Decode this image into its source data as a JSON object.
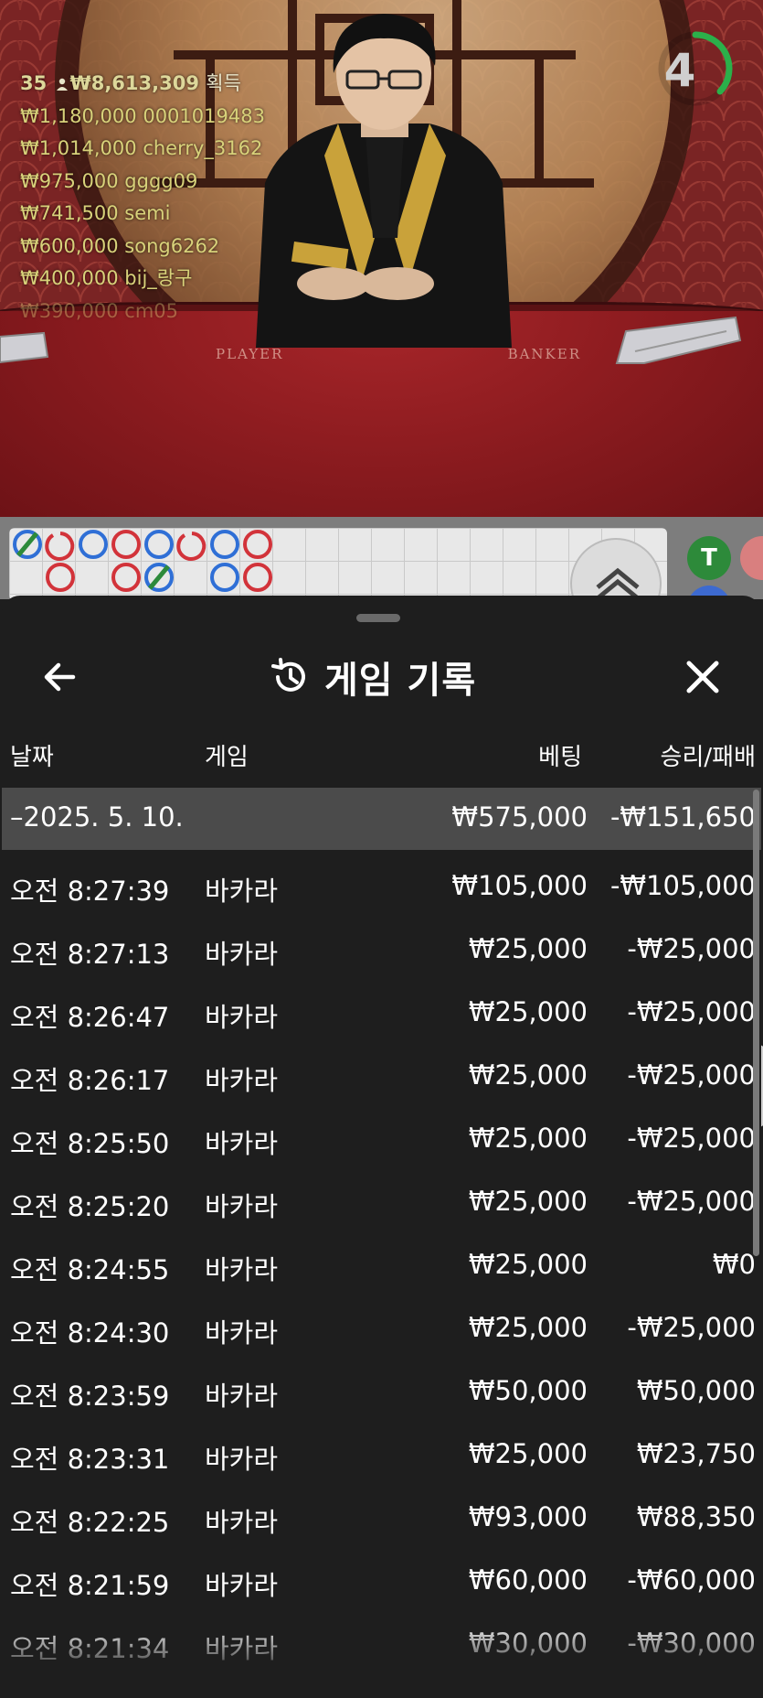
{
  "stream": {
    "summary": {
      "count": "35",
      "total": "₩8,613,309",
      "suffix": "획득"
    },
    "bets": [
      {
        "amount": "₩1,180,000",
        "user": "0001019483"
      },
      {
        "amount": "₩1,014,000",
        "user": "cherry_3162"
      },
      {
        "amount": "₩975,000",
        "user": "gggg09"
      },
      {
        "amount": "₩741,500",
        "user": "semi"
      },
      {
        "amount": "₩600,000",
        "user": "song6262"
      },
      {
        "amount": "₩400,000",
        "user": "bij_랑구"
      },
      {
        "amount": "₩390,000",
        "user": "cm05"
      }
    ],
    "table_labels": {
      "player": "PLAYER",
      "banker": "BANKER"
    },
    "timer": "4"
  },
  "roads": {
    "tie_label": "T"
  },
  "history": {
    "title": "게임 기록",
    "icons": {
      "back": "arrow-left-icon",
      "history": "history-icon",
      "close": "close-icon",
      "collapse": "chevron-up-icon"
    },
    "columns": {
      "date": "날짜",
      "game": "게임",
      "bet": "베팅",
      "result": "승리/패배"
    },
    "day": {
      "date": "–2025. 5. 10.",
      "bet": "₩575,000",
      "result": "-₩151,650"
    },
    "rows": [
      {
        "time": "오전 8:27:39",
        "game": "바카라",
        "bet": "₩105,000",
        "result": "-₩105,000"
      },
      {
        "time": "오전 8:27:13",
        "game": "바카라",
        "bet": "₩25,000",
        "result": "-₩25,000"
      },
      {
        "time": "오전 8:26:47",
        "game": "바카라",
        "bet": "₩25,000",
        "result": "-₩25,000"
      },
      {
        "time": "오전 8:26:17",
        "game": "바카라",
        "bet": "₩25,000",
        "result": "-₩25,000"
      },
      {
        "time": "오전 8:25:50",
        "game": "바카라",
        "bet": "₩25,000",
        "result": "-₩25,000"
      },
      {
        "time": "오전 8:25:20",
        "game": "바카라",
        "bet": "₩25,000",
        "result": "-₩25,000"
      },
      {
        "time": "오전 8:24:55",
        "game": "바카라",
        "bet": "₩25,000",
        "result": "₩0"
      },
      {
        "time": "오전 8:24:30",
        "game": "바카라",
        "bet": "₩25,000",
        "result": "-₩25,000"
      },
      {
        "time": "오전 8:23:59",
        "game": "바카라",
        "bet": "₩50,000",
        "result": "₩50,000"
      },
      {
        "time": "오전 8:23:31",
        "game": "바카라",
        "bet": "₩25,000",
        "result": "₩23,750"
      },
      {
        "time": "오전 8:22:25",
        "game": "바카라",
        "bet": "₩93,000",
        "result": "₩88,350"
      },
      {
        "time": "오전 8:21:59",
        "game": "바카라",
        "bet": "₩60,000",
        "result": "-₩60,000"
      },
      {
        "time": "오전 8:21:34",
        "game": "바카라",
        "bet": "₩30,000",
        "result": "-₩30,000"
      }
    ]
  },
  "colors": {
    "sheet_bg": "#1e1e1e",
    "summary_row_bg": "#4b4b4b",
    "player_blue": "#2f6fd6",
    "banker_red": "#d2333a",
    "tie_green": "#2d8a3a",
    "timer_green": "#2bb04a",
    "bet_text": "#d8d27a"
  }
}
